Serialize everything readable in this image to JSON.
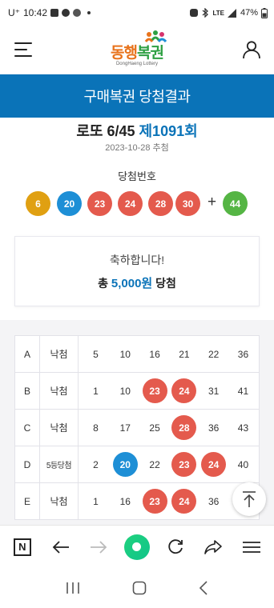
{
  "status_bar": {
    "carrier": "U⁺",
    "time": "10:42",
    "network": "LTE",
    "battery": "47%"
  },
  "app_bar": {
    "logo_main_part1": "동행",
    "logo_main_part2": "복권",
    "logo_sub": "DongHaeng Lottery"
  },
  "banner": {
    "title": "구매복권 당첨결과"
  },
  "draw": {
    "game_name": "로또 6/45",
    "round": "제1091회",
    "date": "2023-10-28 추첨",
    "winning_label": "당첨번호",
    "numbers": [
      "6",
      "20",
      "23",
      "24",
      "28",
      "30"
    ],
    "plus": "+",
    "bonus": "44"
  },
  "result": {
    "congrats": "축하합니다!",
    "total_prefix": "총",
    "total_amount": "5,000원",
    "total_suffix": "당첨"
  },
  "games": [
    {
      "set": "A",
      "result": "낙첨",
      "numbers": [
        "5",
        "10",
        "16",
        "21",
        "22",
        "36"
      ],
      "hits": [
        false,
        false,
        false,
        false,
        false,
        false
      ]
    },
    {
      "set": "B",
      "result": "낙첨",
      "numbers": [
        "1",
        "10",
        "23",
        "24",
        "31",
        "41"
      ],
      "hits": [
        false,
        false,
        true,
        true,
        false,
        false
      ]
    },
    {
      "set": "C",
      "result": "낙첨",
      "numbers": [
        "8",
        "17",
        "25",
        "28",
        "36",
        "43"
      ],
      "hits": [
        false,
        false,
        false,
        true,
        false,
        false
      ]
    },
    {
      "set": "D",
      "result": "5등당첨",
      "numbers": [
        "2",
        "20",
        "22",
        "23",
        "24",
        "40"
      ],
      "hits": [
        false,
        true,
        false,
        true,
        true,
        false
      ]
    },
    {
      "set": "E",
      "result": "낙첨",
      "numbers": [
        "1",
        "16",
        "23",
        "24",
        "36",
        ""
      ],
      "hits": [
        false,
        false,
        true,
        true,
        false,
        false
      ]
    }
  ],
  "colors": {
    "primary": "#0a73b8",
    "ball_yellow": "#e0a012",
    "ball_blue": "#1e8fd6",
    "ball_red": "#e45a4d",
    "ball_green": "#55b544"
  },
  "icons": {
    "menu": "hamburger-icon",
    "profile": "person-icon",
    "scroll_top": "arrow-up-to-line-icon",
    "browser": [
      "naver-n-icon",
      "back-arrow-icon",
      "forward-arrow-icon",
      "green-home-icon",
      "refresh-icon",
      "share-icon",
      "menu-lines-icon"
    ],
    "system_nav": [
      "recent-apps-icon",
      "home-icon",
      "back-icon"
    ]
  }
}
